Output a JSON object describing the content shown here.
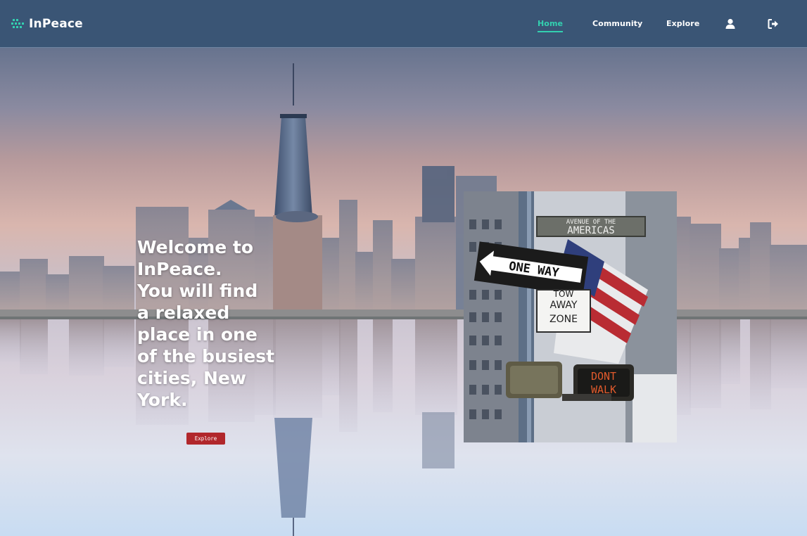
{
  "header": {
    "brand": "InPeace",
    "nav": {
      "home": "Home",
      "community": "Community",
      "explore": "Explore"
    },
    "icons": [
      "brand-logo-icon",
      "user-icon",
      "sign-out-icon"
    ],
    "accent_color": "#33d0b0",
    "bar_color": "#3a5575"
  },
  "hero": {
    "lines": [
      "Welcome to",
      "InPeace.",
      "You will find",
      "a relaxed",
      "place in one",
      "of the busiest",
      "cities, New",
      "York."
    ],
    "button_label": "Explore",
    "button_color": "#b1272b"
  },
  "photo": {
    "street_sign_top": "AVENUE OF THE",
    "street_sign_main": "AMERICAS",
    "one_way": "ONE WAY",
    "tow_zone_1": "TOW",
    "tow_zone_2": "AWAY",
    "tow_zone_3": "ZONE",
    "signal_1": "DONT",
    "signal_2": "WALK"
  }
}
